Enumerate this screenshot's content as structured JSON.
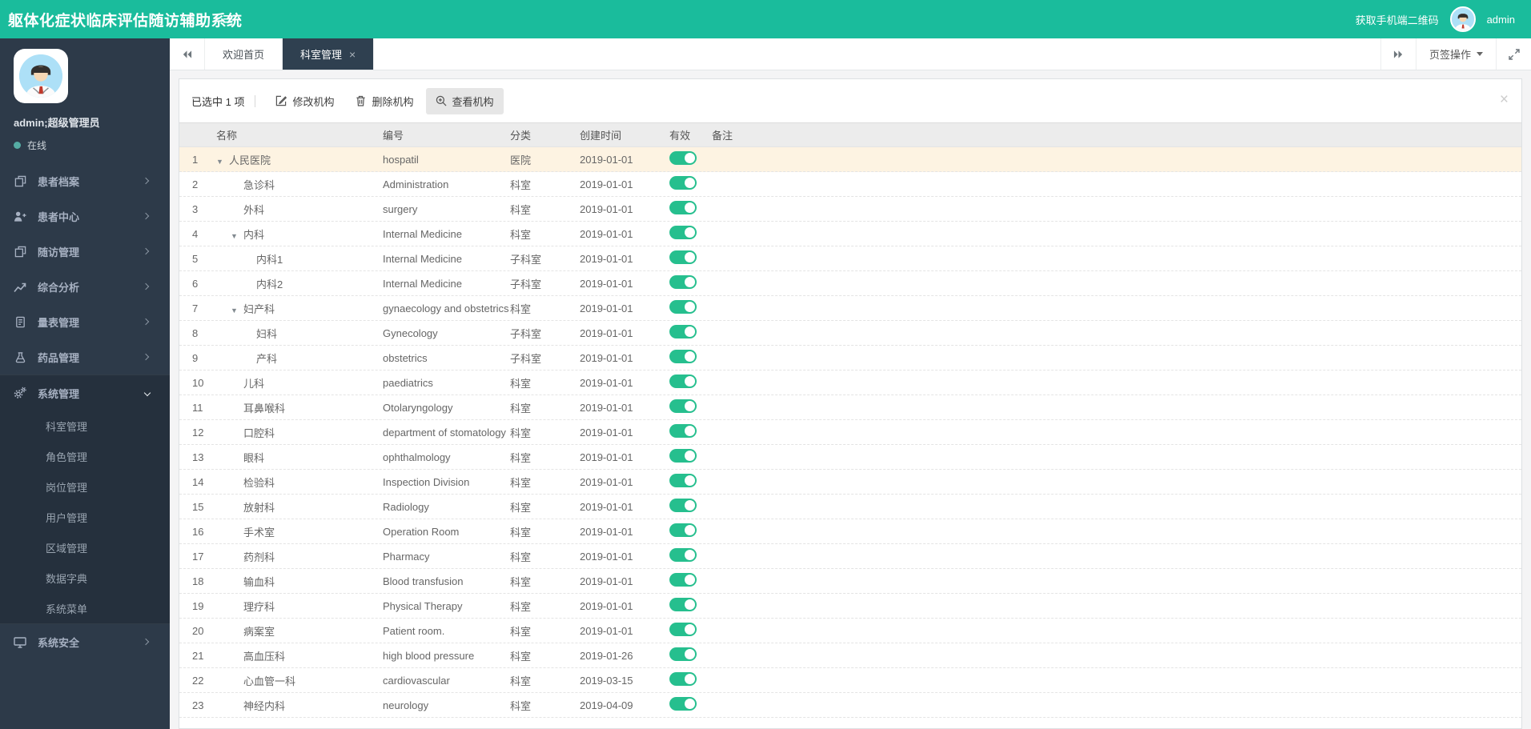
{
  "app": {
    "title": "躯体化症状临床评估随访辅助系统",
    "qr_label": "获取手机端二维码",
    "username": "admin"
  },
  "colors": {
    "accent": "#1abc9c",
    "sidebar": "#2d3a49",
    "sidebar_active_section": "#25303d",
    "active_tab": "#2f4050",
    "selected_row": "#fdf3e2",
    "toggle_on": "#26bf8e",
    "online_dot": "#55aca4"
  },
  "sidebar": {
    "profile": {
      "name": "admin;超级管理员",
      "status": "在线"
    },
    "menu": [
      {
        "label": "患者档案",
        "icon": "files-icon"
      },
      {
        "label": "患者中心",
        "icon": "user-plus-icon"
      },
      {
        "label": "随访管理",
        "icon": "file-icon"
      },
      {
        "label": "综合分析",
        "icon": "chart-line-icon"
      },
      {
        "label": "量表管理",
        "icon": "document-icon"
      },
      {
        "label": "药品管理",
        "icon": "flask-icon"
      },
      {
        "label": "系统管理",
        "icon": "gears-icon",
        "expanded": true,
        "children": [
          "科室管理",
          "角色管理",
          "岗位管理",
          "用户管理",
          "区域管理",
          "数据字典",
          "系统菜单"
        ],
        "active_child": "科室管理"
      },
      {
        "label": "系统安全",
        "icon": "monitor-icon"
      }
    ]
  },
  "tabbar": {
    "tabs": [
      {
        "label": "欢迎首页",
        "active": false
      },
      {
        "label": "科室管理",
        "active": true,
        "closable": true
      }
    ],
    "actions_label": "页签操作"
  },
  "toolbar": {
    "selected_text": "已选中 1 项",
    "buttons": [
      {
        "label": "修改机构",
        "icon": "edit-icon"
      },
      {
        "label": "删除机构",
        "icon": "trash-icon"
      },
      {
        "label": "查看机构",
        "icon": "search-plus-icon",
        "highlighted": true
      }
    ]
  },
  "table": {
    "columns": [
      "名称",
      "编号",
      "分类",
      "创建时间",
      "有效",
      "备注"
    ],
    "rows": [
      {
        "num": 1,
        "name": "人民医院",
        "level": 0,
        "expandable": true,
        "code": "hospatil",
        "category": "医院",
        "created": "2019-01-01",
        "valid": true,
        "selected": true
      },
      {
        "num": 2,
        "name": "急诊科",
        "level": 1,
        "expandable": false,
        "code": "Administration",
        "category": "科室",
        "created": "2019-01-01",
        "valid": true
      },
      {
        "num": 3,
        "name": "外科",
        "level": 1,
        "expandable": false,
        "code": "surgery",
        "category": "科室",
        "created": "2019-01-01",
        "valid": true
      },
      {
        "num": 4,
        "name": "内科",
        "level": 1,
        "expandable": true,
        "code": "Internal Medicine",
        "category": "科室",
        "created": "2019-01-01",
        "valid": true
      },
      {
        "num": 5,
        "name": "内科1",
        "level": 2,
        "expandable": false,
        "code": "Internal Medicine",
        "category": "子科室",
        "created": "2019-01-01",
        "valid": true
      },
      {
        "num": 6,
        "name": "内科2",
        "level": 2,
        "expandable": false,
        "code": "Internal Medicine",
        "category": "子科室",
        "created": "2019-01-01",
        "valid": true
      },
      {
        "num": 7,
        "name": "妇产科",
        "level": 1,
        "expandable": true,
        "code": "gynaecology and obstetrics",
        "category": "科室",
        "created": "2019-01-01",
        "valid": true
      },
      {
        "num": 8,
        "name": "妇科",
        "level": 2,
        "expandable": false,
        "code": "Gynecology",
        "category": "子科室",
        "created": "2019-01-01",
        "valid": true
      },
      {
        "num": 9,
        "name": "产科",
        "level": 2,
        "expandable": false,
        "code": "obstetrics",
        "category": "子科室",
        "created": "2019-01-01",
        "valid": true
      },
      {
        "num": 10,
        "name": "儿科",
        "level": 1,
        "expandable": false,
        "code": "paediatrics",
        "category": "科室",
        "created": "2019-01-01",
        "valid": true
      },
      {
        "num": 11,
        "name": "耳鼻喉科",
        "level": 1,
        "expandable": false,
        "code": "Otolaryngology",
        "category": "科室",
        "created": "2019-01-01",
        "valid": true
      },
      {
        "num": 12,
        "name": "口腔科",
        "level": 1,
        "expandable": false,
        "code": "department of stomatology",
        "category": "科室",
        "created": "2019-01-01",
        "valid": true
      },
      {
        "num": 13,
        "name": "眼科",
        "level": 1,
        "expandable": false,
        "code": "ophthalmology",
        "category": "科室",
        "created": "2019-01-01",
        "valid": true
      },
      {
        "num": 14,
        "name": "检验科",
        "level": 1,
        "expandable": false,
        "code": "Inspection Division",
        "category": "科室",
        "created": "2019-01-01",
        "valid": true
      },
      {
        "num": 15,
        "name": "放射科",
        "level": 1,
        "expandable": false,
        "code": "Radiology",
        "category": "科室",
        "created": "2019-01-01",
        "valid": true
      },
      {
        "num": 16,
        "name": "手术室",
        "level": 1,
        "expandable": false,
        "code": " Operation Room",
        "category": "科室",
        "created": "2019-01-01",
        "valid": true
      },
      {
        "num": 17,
        "name": "药剂科",
        "level": 1,
        "expandable": false,
        "code": "Pharmacy",
        "category": "科室",
        "created": "2019-01-01",
        "valid": true
      },
      {
        "num": 18,
        "name": "输血科",
        "level": 1,
        "expandable": false,
        "code": "Blood transfusion",
        "category": "科室",
        "created": "2019-01-01",
        "valid": true
      },
      {
        "num": 19,
        "name": "理疗科",
        "level": 1,
        "expandable": false,
        "code": "Physical Therapy",
        "category": "科室",
        "created": "2019-01-01",
        "valid": true
      },
      {
        "num": 20,
        "name": "病案室",
        "level": 1,
        "expandable": false,
        "code": "Patient room.",
        "category": "科室",
        "created": "2019-01-01",
        "valid": true
      },
      {
        "num": 21,
        "name": "高血压科",
        "level": 1,
        "expandable": false,
        "code": "high blood pressure",
        "category": "科室",
        "created": "2019-01-26",
        "valid": true
      },
      {
        "num": 22,
        "name": "心血管一科",
        "level": 1,
        "expandable": false,
        "code": "cardiovascular",
        "category": "科室",
        "created": "2019-03-15",
        "valid": true
      },
      {
        "num": 23,
        "name": "神经内科",
        "level": 1,
        "expandable": false,
        "code": "neurology",
        "category": "科室",
        "created": "2019-04-09",
        "valid": true
      }
    ]
  }
}
